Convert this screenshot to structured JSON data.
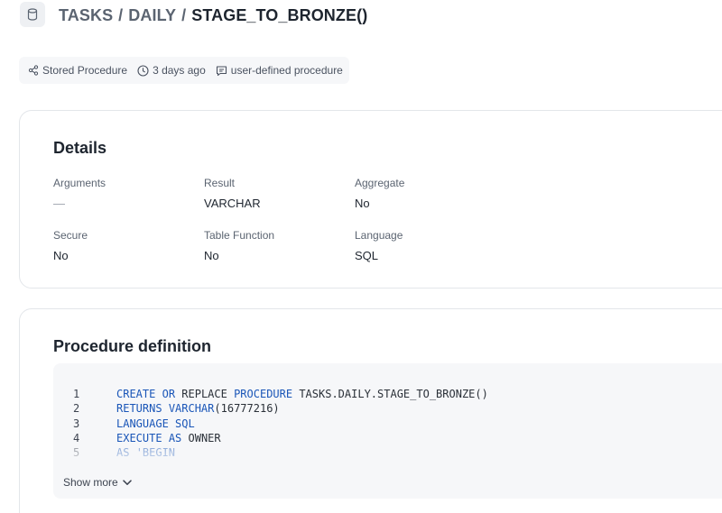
{
  "breadcrumb": {
    "schema": "TASKS",
    "subschema": "DAILY",
    "current": "STAGE_TO_BRONZE()",
    "separator": "/"
  },
  "meta": {
    "type": "Stored Procedure",
    "modified": "3 days ago",
    "description": "user-defined procedure"
  },
  "details": {
    "title": "Details",
    "props": [
      {
        "label": "Arguments",
        "value": "—"
      },
      {
        "label": "Result",
        "value": "VARCHAR"
      },
      {
        "label": "Aggregate",
        "value": "No"
      },
      {
        "label": "Secure",
        "value": "No"
      },
      {
        "label": "Table Function",
        "value": "No"
      },
      {
        "label": "Language",
        "value": "SQL"
      }
    ]
  },
  "procedure": {
    "title": "Procedure definition",
    "lines": [
      {
        "n": "1",
        "kw1": "CREATE",
        "t1": " ",
        "kw2": "OR",
        "t2": " REPLACE ",
        "kw3": "PROCEDURE",
        "t3": " TASKS.DAILY.STAGE_TO_BRONZE()"
      },
      {
        "n": "2",
        "kw1": "RETURNS",
        "t1": " ",
        "kw2": "VARCHAR",
        "t2": "(16777216)",
        "kw3": "",
        "t3": ""
      },
      {
        "n": "3",
        "kw1": "LANGUAGE",
        "t1": " ",
        "kw2": "SQL",
        "t2": "",
        "kw3": "",
        "t3": ""
      },
      {
        "n": "4",
        "kw1": "EXECUTE",
        "t1": " ",
        "kw2": "AS",
        "t2": " OWNER",
        "kw3": "",
        "t3": ""
      },
      {
        "n": "5",
        "kw1": "AS",
        "t1": " ",
        "kw2": "'BEGIN",
        "t2": "",
        "kw3": "",
        "t3": ""
      }
    ],
    "show_more": "Show more"
  }
}
